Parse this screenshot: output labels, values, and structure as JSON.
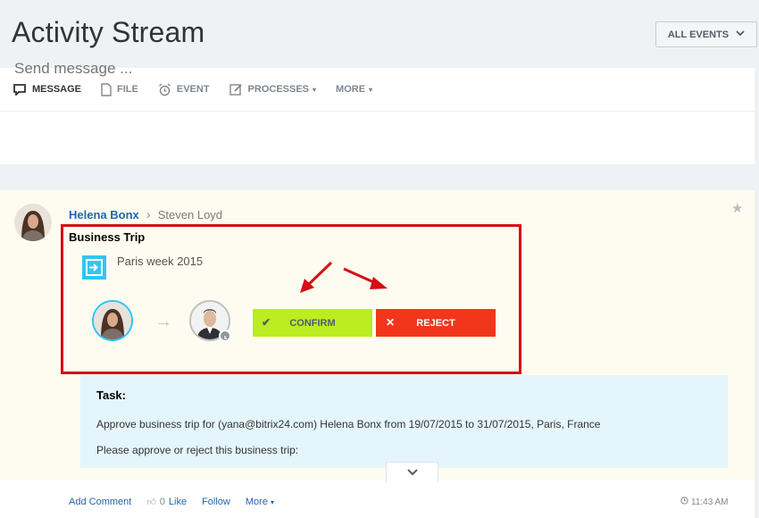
{
  "page": {
    "title": "Activity Stream"
  },
  "filter": {
    "label": "ALL EVENTS"
  },
  "composer": {
    "tabs": [
      {
        "label": "MESSAGE",
        "icon": "message-icon"
      },
      {
        "label": "FILE",
        "icon": "file-icon"
      },
      {
        "label": "EVENT",
        "icon": "alarm-clock-icon"
      },
      {
        "label": "PROCESSES",
        "icon": "edit-icon"
      },
      {
        "label": "MORE"
      }
    ],
    "placeholder": "Send message ..."
  },
  "post": {
    "author": "Helena Bonx",
    "recipient": "Steven Loyd",
    "workflow_title": "Business Trip",
    "process_name": "Paris week 2015",
    "confirm_label": "CONFIRM",
    "reject_label": "REJECT",
    "task": {
      "heading": "Task:",
      "description": "Approve business trip for (yana@bitrix24.com) Helena Bonx from 19/07/2015 to 31/07/2015, Paris, France",
      "prompt": "Please approve or reject this business trip:"
    },
    "actions": {
      "add_comment": "Add Comment",
      "like_count": "0",
      "like": "Like",
      "follow": "Follow",
      "more": "More"
    },
    "time": "11:43 AM"
  },
  "colors": {
    "confirm": "#bbed21",
    "reject": "#f1361b",
    "highlight_border": "#d40e14",
    "link": "#2067b0",
    "task_bg": "#e4f5fc",
    "post_bg": "#fefcf0"
  }
}
